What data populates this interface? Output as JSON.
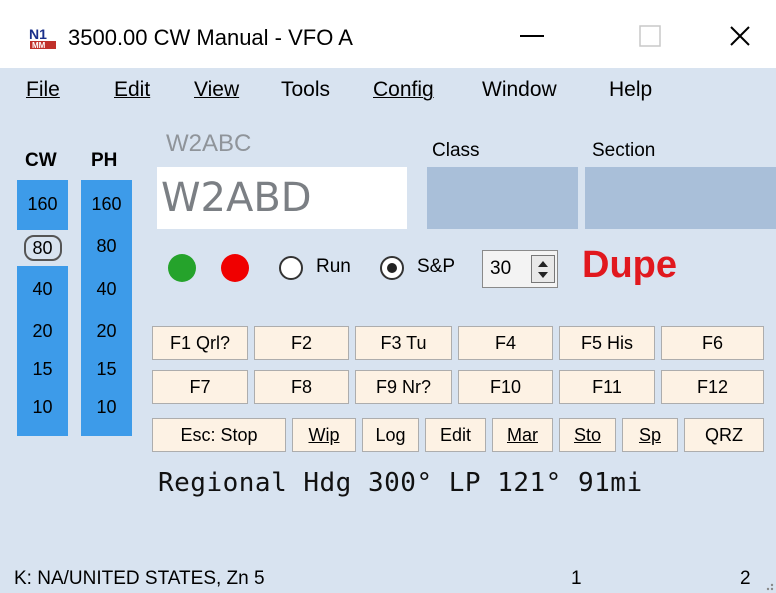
{
  "window": {
    "title": "3500.00 CW Manual - VFO A",
    "min_glyph": "—",
    "close_glyph": "✕"
  },
  "menu": [
    "File",
    "Edit",
    "View",
    "Tools",
    "Config",
    "Window",
    "Help"
  ],
  "bands": {
    "cw_label": "CW",
    "ph_label": "PH",
    "cw": [
      "160",
      "80",
      "40",
      "20",
      "15",
      "10"
    ],
    "ph": [
      "160",
      "80",
      "40",
      "20",
      "15",
      "10"
    ],
    "selected_cw": "80",
    "color": "#3d9be9"
  },
  "entry": {
    "call_label": "W2ABC",
    "call_value": "W2ABD",
    "class_label": "Class",
    "section_label": "Section"
  },
  "mode": {
    "run_label": "Run",
    "sp_label": "S&P",
    "selected": "S&P",
    "spin_value": "30"
  },
  "dupe": {
    "text": "Dupe",
    "color": "#e1181e"
  },
  "fkeys_row1": [
    "F1 Qrl?",
    "F2",
    "F3 Tu",
    "F4",
    "F5 His",
    "F6"
  ],
  "fkeys_row2": [
    "F7",
    "F8",
    "F9 Nr?",
    "F10",
    "F11",
    "F12"
  ],
  "buttons_row3": [
    "Esc: Stop",
    "Wip",
    "Log",
    "Edit",
    "Mar",
    "Sto",
    "Sp",
    "QRZ"
  ],
  "info_line": "Regional Hdg 300° LP 121° 91mi",
  "status": {
    "left": "K: NA/UNITED STATES, Zn 5",
    "mid": "1",
    "right": "2"
  },
  "icons": {
    "app": "n1mm-logo-icon",
    "minimize": "minimize-icon",
    "maximize": "maximize-icon",
    "close": "close-icon"
  }
}
